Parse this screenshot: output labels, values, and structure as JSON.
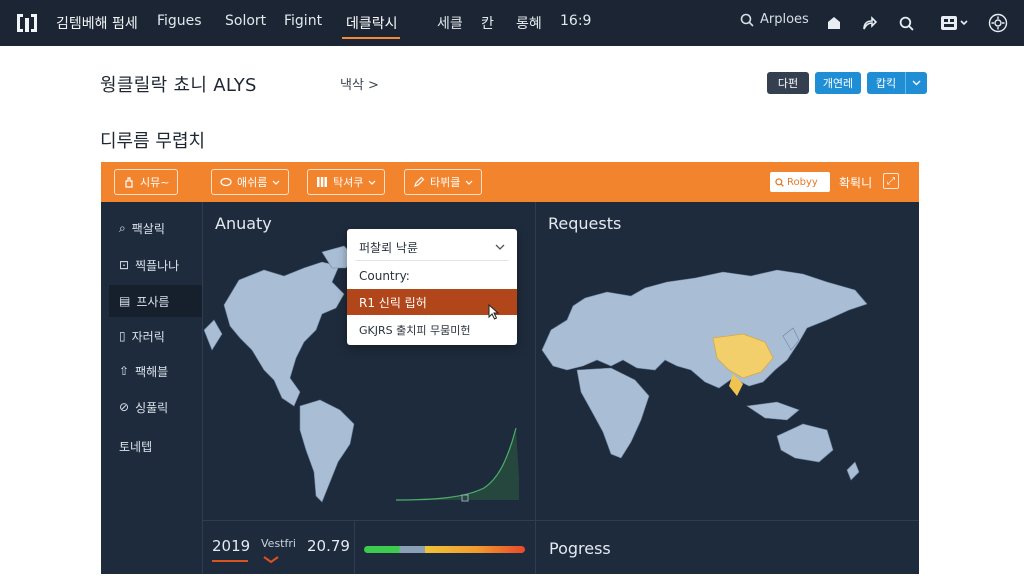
{
  "nav": {
    "brand": "김템베해 펌세",
    "links": [
      "Figues",
      "Solort",
      "Figint",
      "데클락시",
      "세클",
      "칸",
      "롱혜",
      "16:9"
    ],
    "active_index": 3,
    "search_label": "Arploes",
    "accent": "#f28a3a"
  },
  "header": {
    "title": "웡클릴락 쵸니 ALYS",
    "breadcrumb": "낵삭 >",
    "btn_dark": "다펀",
    "btn_blue1": "개연레",
    "btn_blue2": "캅킥"
  },
  "section_title": "디루름 무렵치",
  "toolbar": {
    "filters": [
      "시뮤~",
      "애쉬름",
      "탁셔쿠",
      "타뷔클"
    ],
    "search_text": "Robyy",
    "label": "확튁니",
    "color": "#f2842e"
  },
  "sidebar": {
    "items": [
      "팩살릭",
      "찍플나나",
      "프사름",
      "자러릭",
      "팩해블",
      "싱풀릭",
      "토네텝"
    ],
    "active_index": 2
  },
  "cards": {
    "left_title": "Anuaty",
    "right_title": "Requests",
    "progress_title": "Pogress"
  },
  "dropdown": {
    "header": "퍼찰뢰 낙륜",
    "option_country": "Country:",
    "option_selected": "R1 신릭 립허",
    "option_third": "GKJRS 출치피 무뭄미헌"
  },
  "stats": {
    "year": "2019",
    "mid_label": "Vestfri",
    "value": "20.79"
  }
}
